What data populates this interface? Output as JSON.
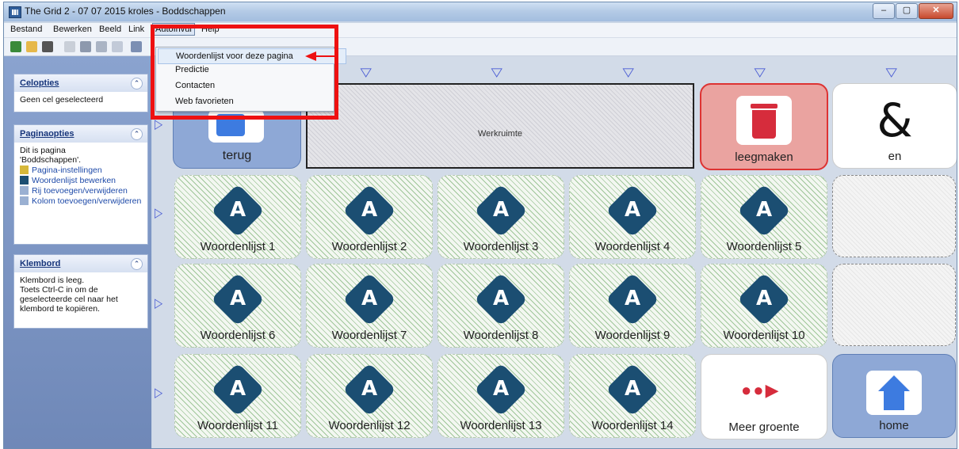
{
  "window": {
    "title": "The Grid 2 - 07 07 2015 kroles - Boddschappen",
    "min": "–",
    "max": "▢",
    "close": "✕"
  },
  "menubar": {
    "items": [
      "Bestand",
      "Bewerken",
      "Beeld",
      "Link",
      "AutoInvul",
      "Help"
    ]
  },
  "dropdown": {
    "items": [
      "Woordenlijst voor deze pagina",
      "Predictie",
      "Contacten",
      "Web favorieten"
    ]
  },
  "sidebar": {
    "celopties": {
      "title": "Celopties",
      "text": "Geen cel geselecteerd"
    },
    "paginaopties": {
      "title": "Paginaopties",
      "text1": "Dit is pagina",
      "text2": "'Boddschappen'.",
      "links": [
        "Pagina-instellingen",
        "Woordenlijst bewerken",
        "Rij toevoegen/verwijderen",
        "Kolom toevoegen/verwijderen"
      ]
    },
    "klembord": {
      "title": "Klembord",
      "text1": "Klembord is leeg.",
      "text2": "Toets Ctrl-C in om de geselecteerde cel naar het klembord te kopiëren."
    }
  },
  "grid": {
    "top_markers": [
      "▽",
      "▽",
      "▽",
      "▽",
      "▽"
    ],
    "side_marker": "▷",
    "row1": {
      "back": "terug",
      "workspace": "Werkruimte",
      "clear": "leegmaken",
      "and_symbol": "&",
      "and": "en"
    },
    "wordlist_letter": "A",
    "wordlists": [
      "Woordenlijst 1",
      "Woordenlijst 2",
      "Woordenlijst 3",
      "Woordenlijst 4",
      "Woordenlijst 5",
      "Woordenlijst 6",
      "Woordenlijst 7",
      "Woordenlijst 8",
      "Woordenlijst 9",
      "Woordenlijst 10",
      "Woordenlijst 11",
      "Woordenlijst 12",
      "Woordenlijst 13",
      "Woordenlijst 14"
    ],
    "more": "Meer groente",
    "home": "home"
  },
  "colors": {
    "accent_red": "#ee1111",
    "diamond": "#1b4e72",
    "clear_bg": "#eaa3a0",
    "home_bg": "#8ea8d6"
  }
}
